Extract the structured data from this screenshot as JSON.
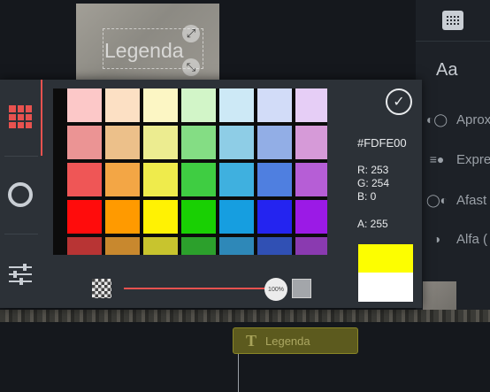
{
  "canvas_preview": {
    "caption_text": "Legenda"
  },
  "right_panel": {
    "keyboard_icon": "keyboard-icon",
    "font_button": "Aa",
    "items": [
      {
        "label": "Aprox",
        "icon": "zoom-in-toggle-icon"
      },
      {
        "label": "Expre",
        "icon": "express-motion-icon"
      },
      {
        "label": "Afast",
        "icon": "zoom-out-toggle-icon"
      },
      {
        "label": "Alfa (",
        "icon": "alpha-half-circle-icon"
      }
    ]
  },
  "timeline": {
    "caption_clip_icon": "T",
    "caption_clip_label": "Legenda"
  },
  "color_picker": {
    "tools": [
      "palette-grid-icon",
      "color-wheel-icon",
      "adjust-sliders-icon"
    ],
    "active_tool": "palette-grid-icon",
    "swatch_rows": [
      [
        "#fcc8c8",
        "#fce0c4",
        "#fcf6c4",
        "#d2f5c8",
        "#cde9f6",
        "#d2dcf8",
        "#e6cef6"
      ],
      [
        "#eb9494",
        "#ecc08a",
        "#ecec90",
        "#84dd84",
        "#8ecde6",
        "#92aee6",
        "#d69ad8"
      ],
      [
        "#ef5656",
        "#f3a645",
        "#efeb4c",
        "#3fcd42",
        "#3fb0df",
        "#4f7fe0",
        "#b65ed6"
      ],
      [
        "#ff0c0c",
        "#ff9a00",
        "#fff203",
        "#19d003",
        "#169ee0",
        "#2424f0",
        "#9b1ae6"
      ],
      [
        "#b83434",
        "#c8882e",
        "#c8c42e",
        "#2ca02c",
        "#2e88b8",
        "#3050b4",
        "#8a3ab0"
      ]
    ],
    "hex": "#FDFE00",
    "r": "R: 253",
    "g": "G: 254",
    "b": "B: 0",
    "a": "A: 255",
    "alpha_percent": "100%",
    "alpha_value": 1.0,
    "selected_color": "#fdfe00",
    "previous_color": "#ffffff",
    "accent_color": "#e8524f"
  }
}
